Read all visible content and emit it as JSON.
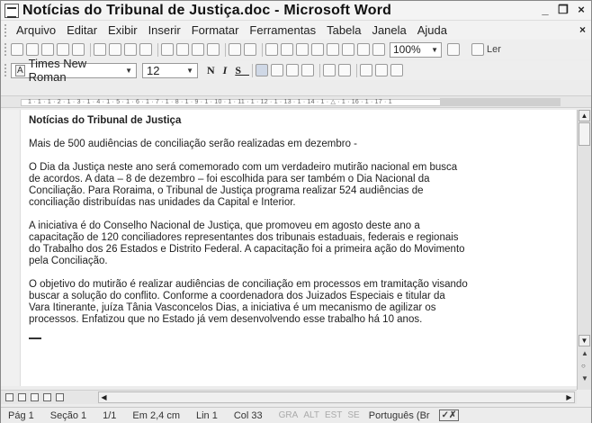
{
  "window": {
    "title": "Notícias do Tribunal de Justiça.doc - Microsoft Word",
    "controls": {
      "minimize": "_",
      "restore": "❐",
      "close": "×"
    }
  },
  "menu": {
    "items": [
      "Arquivo",
      "Editar",
      "Exibir",
      "Inserir",
      "Formatar",
      "Ferramentas",
      "Tabela",
      "Janela",
      "Ajuda"
    ],
    "close": "×"
  },
  "toolbar": {
    "zoom": "100%",
    "read_label": "Ler"
  },
  "formatting": {
    "style_badge": "A",
    "font": "Times New Roman",
    "size": "12",
    "bold": "N",
    "italic": "I",
    "underline": "S"
  },
  "ruler": {
    "text": "1 · 1 · 1 · 2 · 1 · 3 · 1 · 4 · 1 · 5 · 1 · 6 · 1 · 7 · 1 · 8 · 1 · 9 · 1 · 10 · 1 · 11 · 1 · 12 · 1 · 13 · 1 · 14 · 1 · △ · 1 · 16 · 1 · 17 · 1"
  },
  "document": {
    "title": "Notícias do Tribunal de Justiça",
    "paragraphs": [
      "Mais de 500 audiências de conciliação serão realizadas em dezembro -",
      "O Dia da Justiça neste ano será comemorado com um verdadeiro mutirão nacional em busca\nde acordos. A data – 8 de dezembro – foi escolhida para ser também o Dia Nacional da\nConciliação. Para Roraima, o Tribunal de Justiça programa realizar 524 audiências de\nconciliação distribuídas nas unidades da Capital e Interior.",
      "A iniciativa é do Conselho Nacional de Justiça, que promoveu em agosto deste ano a\ncapacitação de 120 conciliadores representantes dos tribunais estaduais, federais e regionais\ndo Trabalho dos 26 Estados e Distrito Federal. A capacitação foi a primeira ação do Movimento\npela Conciliação.",
      "O objetivo do mutirão é realizar audiências de conciliação em processos em tramitação visando\nbuscar a solução do conflito. Conforme a coordenadora dos Juizados Especiais e titular da\nVara Itinerante, juíza Tânia Vasconcelos Dias, a iniciativa é um mecanismo de agilizar os\nprocessos. Enfatizou que no Estado já vem desenvolvendo esse trabalho há 10 anos."
    ]
  },
  "status": {
    "page": "Pág 1",
    "section": "Seção 1",
    "pages": "1/1",
    "at": "Em 2,4 cm",
    "line": "Lin 1",
    "col": "Col 33",
    "rec": "GRA",
    "trk": "ALT",
    "ext": "EST",
    "ovr": "SE",
    "language": "Português (Br",
    "spell_icon": "✓✗"
  }
}
